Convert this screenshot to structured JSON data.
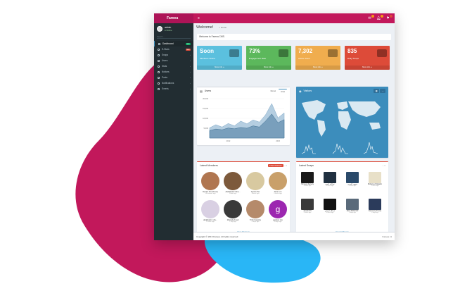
{
  "colors": {
    "accent": "#c2185b",
    "sky": "#29b6f6",
    "sidebar": "#222d32",
    "aqua": "#5bc0de",
    "green": "#5cb85c",
    "yellow": "#f0ad4e",
    "red": "#dd4b39",
    "map": "#3c8dbc"
  },
  "app": {
    "brand": "Fareea",
    "menu_icon": "hamburger-icon"
  },
  "topbar": {
    "icons": [
      "envelope-icon",
      "bell-icon",
      "flag-icon"
    ]
  },
  "sidebar": {
    "user_name": "admin",
    "user_status": "● Online",
    "search_placeholder": "Search...",
    "items": [
      {
        "label": "Dashboard",
        "badge": "new",
        "badge_color": "#00a65a"
      },
      {
        "label": "E-Stars",
        "badge": "new",
        "badge_color": "#dd4b39"
      },
      {
        "label": "Snaps",
        "badge": ""
      },
      {
        "label": "Users",
        "badge": ""
      },
      {
        "label": "Stats",
        "badge": ""
      },
      {
        "label": "Notices",
        "badge": ""
      },
      {
        "label": "Posts",
        "badge": ""
      },
      {
        "label": "Notifications",
        "badge": ""
      },
      {
        "label": "Events",
        "badge": ""
      }
    ]
  },
  "page": {
    "title": "Welcome!",
    "breadcrumb": "⌂ Home",
    "welcome_text": "Welcome to Fareea CMS."
  },
  "stats": [
    {
      "number": "Soon",
      "label": "Members Online",
      "footer": "More info ➔",
      "color": "#5bc0de"
    },
    {
      "number": "73%",
      "label": "Engagement Rate",
      "footer": "More info ➔",
      "color": "#5cb85c"
    },
    {
      "number": "7,302",
      "label": "Active Users",
      "footer": "More info ➔",
      "color": "#f0ad4e"
    },
    {
      "number": "835",
      "label": "Daily Snaps",
      "footer": "More info ➔",
      "color": "#dd4b39"
    }
  ],
  "users_box": {
    "title": "Users",
    "tabs": [
      "Donut",
      "Area"
    ],
    "active_tab": "Area"
  },
  "chart_data": {
    "type": "area",
    "title": "Users",
    "x": [
      "2010",
      "2011",
      "2011.5",
      "2012",
      "2012.5",
      "2013",
      "2013.5",
      "2014",
      "2014.5",
      "2015",
      "2015.5",
      "2016",
      "2016.5"
    ],
    "series": [
      {
        "values": [
          5200,
          6800,
          5600,
          7400,
          6200,
          8600,
          7200,
          9200,
          8100,
          11800,
          17500,
          10200,
          12800
        ]
      },
      {
        "values": [
          3800,
          4600,
          4200,
          5100,
          4700,
          5400,
          5000,
          6200,
          5600,
          8600,
          12200,
          7800,
          9400
        ]
      }
    ],
    "ytick_labels": [
      "20,000",
      "15,000",
      "10,000",
      "5,000"
    ],
    "xtick_labels": [
      "2012",
      "2016"
    ],
    "ylim": [
      0,
      20000
    ]
  },
  "visitors_box": {
    "title": "Visitors",
    "buttons": [
      "calendar-icon",
      "minus-icon"
    ]
  },
  "members_box": {
    "title": "Latest Members",
    "badge": "8 New Members",
    "members": [
      {
        "name": "Rezaei Alrushoudy",
        "date": "14 minutes ago",
        "tone": "#b07650"
      },
      {
        "name": "Abdelkader Alna...",
        "date": "20min ago",
        "tone": "#7d5a3c"
      },
      {
        "name": "Tyreka Tax",
        "date": "1hours ago",
        "tone": "#d8c9a0"
      },
      {
        "name": "Stiva Leo",
        "date": "5 hours ago",
        "tone": "#c9a06a"
      },
      {
        "name": "abdelkarim sha...",
        "date": "1 hours ago",
        "tone": "#d9d0e3"
      },
      {
        "name": "Mustafa Amari",
        "date": "1 day ago",
        "tone": "#3a3a3a"
      },
      {
        "name": "Trish Cargotty",
        "date": "2 days ago",
        "tone": "#b58a6a"
      },
      {
        "name": "gasylan she",
        "date": "4 days ago",
        "tone": "#9c27b0"
      }
    ],
    "view_all": "View All Users"
  },
  "snaps_box": {
    "title": "Latest Snaps",
    "snaps": [
      {
        "name": "Shrooog Farsary",
        "date": "4 hours ago",
        "tone": "#1a1a1a"
      },
      {
        "name": "عبدالله عاصي",
        "date": "4 hours ago",
        "tone": "#203040"
      },
      {
        "name": "منصور الحربي",
        "date": "5 hours ago",
        "tone": "#2a4a6a"
      },
      {
        "name": "Mohamed Mogaho",
        "date": "5 hours ago",
        "tone": "#e8e0c8"
      },
      {
        "name": "Jevelio 9/1",
        "date": "5 hours ago",
        "tone": "#3a3a3a"
      },
      {
        "name": "عبدالله الزبادي",
        "date": "6 hours ago",
        "tone": "#111"
      },
      {
        "name": "Abou Richard II",
        "date": "2 days ago",
        "tone": "#5a6a7a"
      },
      {
        "name": "Farmouty Frenzy",
        "date": "2 days ago",
        "tone": "#2b3b5b"
      }
    ],
    "view_all": "View All Snaps"
  },
  "footer": {
    "copyright": "Copyright © 2016 Fareea. All rights reserved.",
    "version": "Fareea v1"
  }
}
